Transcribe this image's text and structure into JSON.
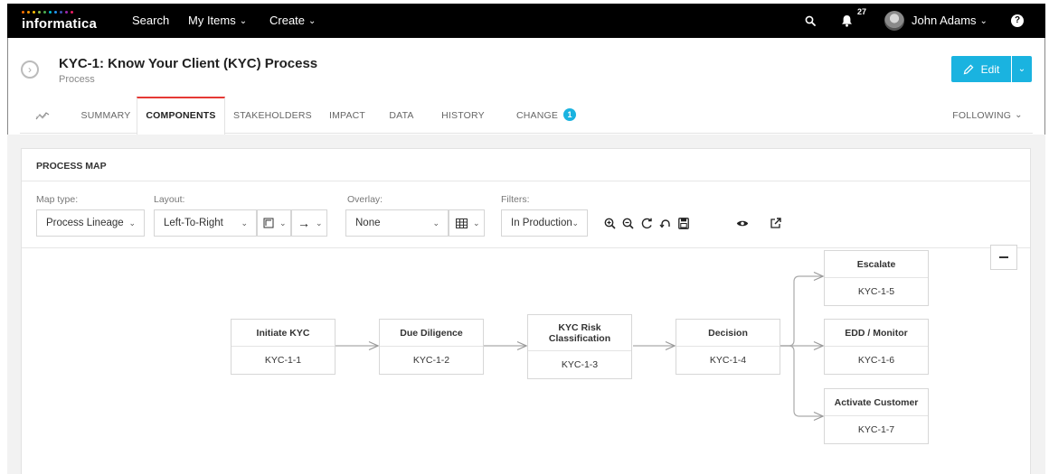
{
  "app": {
    "logo_text": "informatica",
    "nav": {
      "search": "Search",
      "my_items": "My Items",
      "create": "Create"
    },
    "notifications_count": "27",
    "user_name": "John Adams",
    "help_glyph": "?"
  },
  "header": {
    "title": "KYC-1: Know Your Client (KYC) Process",
    "subtitle": "Process",
    "edit_label": "Edit"
  },
  "tabs": [
    {
      "label": "SUMMARY"
    },
    {
      "label": "COMPONENTS",
      "active": true
    },
    {
      "label": "STAKEHOLDERS"
    },
    {
      "label": "IMPACT"
    },
    {
      "label": "DATA"
    },
    {
      "label": "HISTORY"
    },
    {
      "label": "CHANGE",
      "badge": "1"
    }
  ],
  "following_label": "FOLLOWING",
  "panel": {
    "title": "PROCESS MAP",
    "controls": {
      "map_type_label": "Map type:",
      "map_type_value": "Process Lineage",
      "layout_label": "Layout:",
      "layout_value": "Left-To-Right",
      "overlay_label": "Overlay:",
      "overlay_value": "None",
      "filters_label": "Filters:",
      "filters_value": "In Production"
    }
  },
  "nodes": [
    {
      "title": "Initiate KYC",
      "id": "KYC-1-1"
    },
    {
      "title": "Due Diligence",
      "id": "KYC-1-2"
    },
    {
      "title": "KYC Risk Classification",
      "id": "KYC-1-3"
    },
    {
      "title": "Decision",
      "id": "KYC-1-4"
    },
    {
      "title": "Escalate",
      "id": "KYC-1-5"
    },
    {
      "title": "EDD / Monitor",
      "id": "KYC-1-6"
    },
    {
      "title": "Activate Customer",
      "id": "KYC-1-7"
    }
  ],
  "colors": {
    "accent": "#1ab3e0",
    "active_tab": "#e53935",
    "topbar": "#000000"
  }
}
